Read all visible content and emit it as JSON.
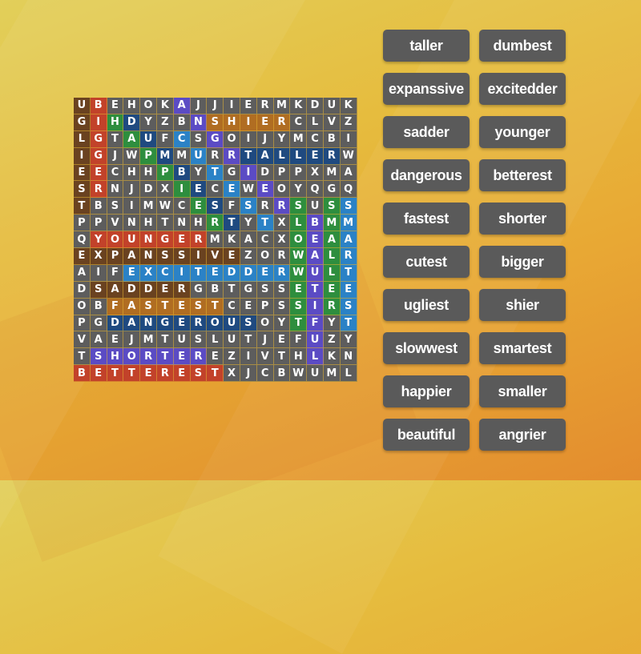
{
  "colors": {
    "brown": "#6a4220",
    "red": "#c2422a",
    "orange": "#b06d22",
    "green": "#2e8e3e",
    "navy": "#1f4a80",
    "blue": "#2b82c6",
    "purple": "#5b4bc4",
    "cell_default": "#5d5d5d"
  },
  "grid": {
    "rows": [
      "UBEHOKAJJIERMKDUK",
      "GIHDYZBNSHIERCLVZ",
      "LGTAUFCSGOIJYMCBI",
      "IGJWPMMURRTALLERW",
      "EECHHPBYTGIDPPXMA",
      "SRNJDXIECEWEOYQGQ",
      "TBSIMWCESFSRRSUSS",
      "PPVNHTNHRTYTXLBMM",
      "QYOUNGERMKACXOEAA",
      "EXPANSSIVEZORWALR",
      "AIFEXCITEDDERWULT",
      "DSADDERGBTGSSETEE",
      "OBFASTESTCEPSSIRS",
      "PGDANGEROUSOYTFYT",
      "VAEJMTUSLUTJEFUZY",
      "TSHORTEREZIVTHLKN",
      "BETTERESTXJCBWUML"
    ],
    "found_words": [
      {
        "word": "ugliest",
        "start": [
          0,
          0
        ],
        "dir": [
          1,
          0
        ],
        "color": "brown"
      },
      {
        "word": "bigger",
        "start": [
          0,
          1
        ],
        "dir": [
          1,
          0
        ],
        "color": "red"
      },
      {
        "word": "angrier",
        "start": [
          0,
          6
        ],
        "dir": [
          1,
          1
        ],
        "color": "purple"
      },
      {
        "word": "happier",
        "start": [
          1,
          2
        ],
        "dir": [
          1,
          1
        ],
        "color": "green"
      },
      {
        "word": "dumbest",
        "start": [
          1,
          3
        ],
        "dir": [
          1,
          1
        ],
        "color": "navy"
      },
      {
        "word": "shier",
        "start": [
          1,
          8
        ],
        "dir": [
          0,
          1
        ],
        "color": "orange"
      },
      {
        "word": "cutest",
        "start": [
          2,
          6
        ],
        "dir": [
          1,
          1
        ],
        "color": "blue"
      },
      {
        "word": "taller",
        "start": [
          3,
          10
        ],
        "dir": [
          0,
          1
        ],
        "color": "navy"
      },
      {
        "word": "slowwest",
        "start": [
          6,
          13
        ],
        "dir": [
          1,
          0
        ],
        "color": "green"
      },
      {
        "word": "smaller",
        "start": [
          6,
          15
        ],
        "dir": [
          1,
          0
        ],
        "color": "green"
      },
      {
        "word": "smartest",
        "start": [
          6,
          16
        ],
        "dir": [
          1,
          0
        ],
        "color": "blue"
      },
      {
        "word": "beautiful",
        "start": [
          7,
          14
        ],
        "dir": [
          1,
          0
        ],
        "color": "purple"
      },
      {
        "word": "younger",
        "start": [
          8,
          1
        ],
        "dir": [
          0,
          1
        ],
        "color": "red"
      },
      {
        "word": "expanssive",
        "start": [
          9,
          0
        ],
        "dir": [
          0,
          1
        ],
        "color": "brown"
      },
      {
        "word": "excitedder",
        "start": [
          10,
          3
        ],
        "dir": [
          0,
          1
        ],
        "color": "blue"
      },
      {
        "word": "sadder",
        "start": [
          11,
          1
        ],
        "dir": [
          0,
          1
        ],
        "color": "brown"
      },
      {
        "word": "fastest",
        "start": [
          12,
          2
        ],
        "dir": [
          0,
          1
        ],
        "color": "orange"
      },
      {
        "word": "dangerous",
        "start": [
          13,
          2
        ],
        "dir": [
          0,
          1
        ],
        "color": "navy"
      },
      {
        "word": "shorter",
        "start": [
          15,
          1
        ],
        "dir": [
          0,
          1
        ],
        "color": "purple"
      },
      {
        "word": "betterest",
        "start": [
          16,
          0
        ],
        "dir": [
          0,
          1
        ],
        "color": "red"
      }
    ]
  },
  "word_buttons": [
    "taller",
    "dumbest",
    "expanssive",
    "excitedder",
    "sadder",
    "younger",
    "dangerous",
    "betterest",
    "fastest",
    "shorter",
    "cutest",
    "bigger",
    "ugliest",
    "shier",
    "slowwest",
    "smartest",
    "happier",
    "smaller",
    "beautiful",
    "angrier"
  ]
}
